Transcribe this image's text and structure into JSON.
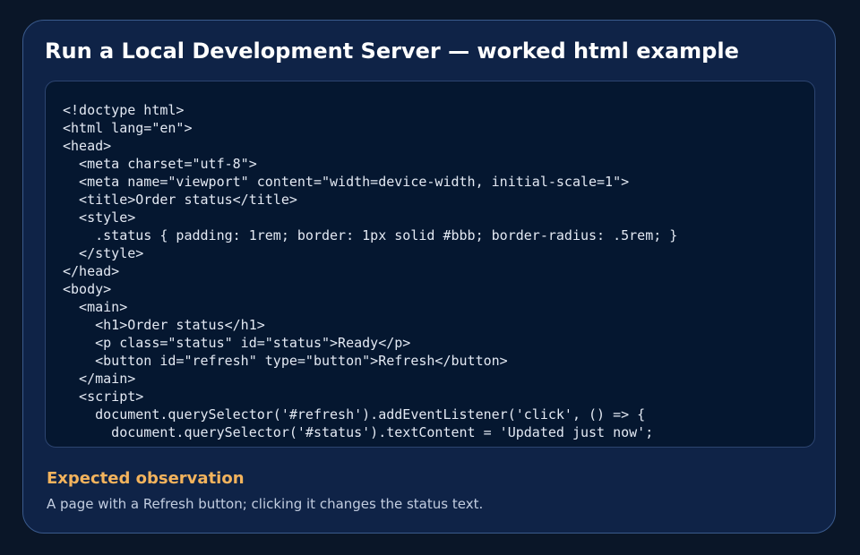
{
  "card": {
    "title": "Run a Local Development Server — worked html example",
    "code": "<!doctype html>\n<html lang=\"en\">\n<head>\n  <meta charset=\"utf-8\">\n  <meta name=\"viewport\" content=\"width=device-width, initial-scale=1\">\n  <title>Order status</title>\n  <style>\n    .status { padding: 1rem; border: 1px solid #bbb; border-radius: .5rem; }\n  </style>\n</head>\n<body>\n  <main>\n    <h1>Order status</h1>\n    <p class=\"status\" id=\"status\">Ready</p>\n    <button id=\"refresh\" type=\"button\">Refresh</button>\n  </main>\n  <script>\n    document.querySelector('#refresh').addEventListener('click', () => {\n      document.querySelector('#status').textContent = 'Updated just now';",
    "observation_heading": "Expected observation",
    "observation_text": "A page with a Refresh button; clicking it changes the status text."
  }
}
